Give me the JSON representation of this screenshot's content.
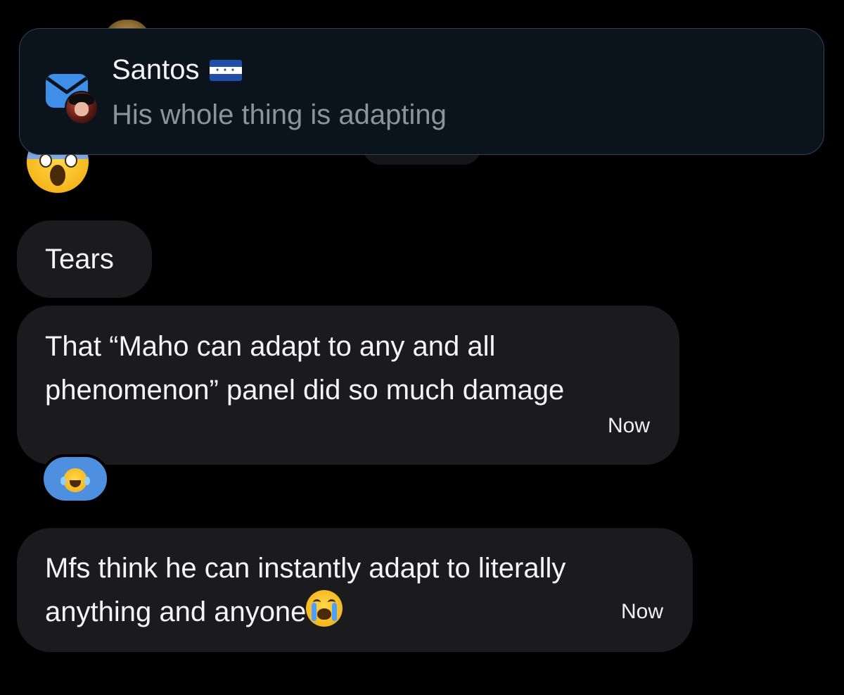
{
  "notification": {
    "sender": "Santos",
    "sender_flag": "honduras-flag",
    "preview": "His whole thing is adapting",
    "app_icon": "mail-icon",
    "colors": {
      "background": "#0b141d",
      "border": "#2f4453",
      "preview_text": "#8b939b"
    }
  },
  "messages": [
    {
      "text": "Tears",
      "timestamp": null
    },
    {
      "text": "That “Maho can adapt to any and all phenomenon” panel did so much damage",
      "timestamp": "Now",
      "reaction": "face-with-tears-of-joy-emoji"
    },
    {
      "text": "Mfs think he can instantly adapt to literally anything and anyone",
      "trailing_emoji": "loudly-crying-face-emoji",
      "timestamp": "Now"
    }
  ],
  "colors": {
    "page_background": "#000000",
    "bubble": "#1b1b1d",
    "reaction_pill": "#4e8fe0"
  }
}
